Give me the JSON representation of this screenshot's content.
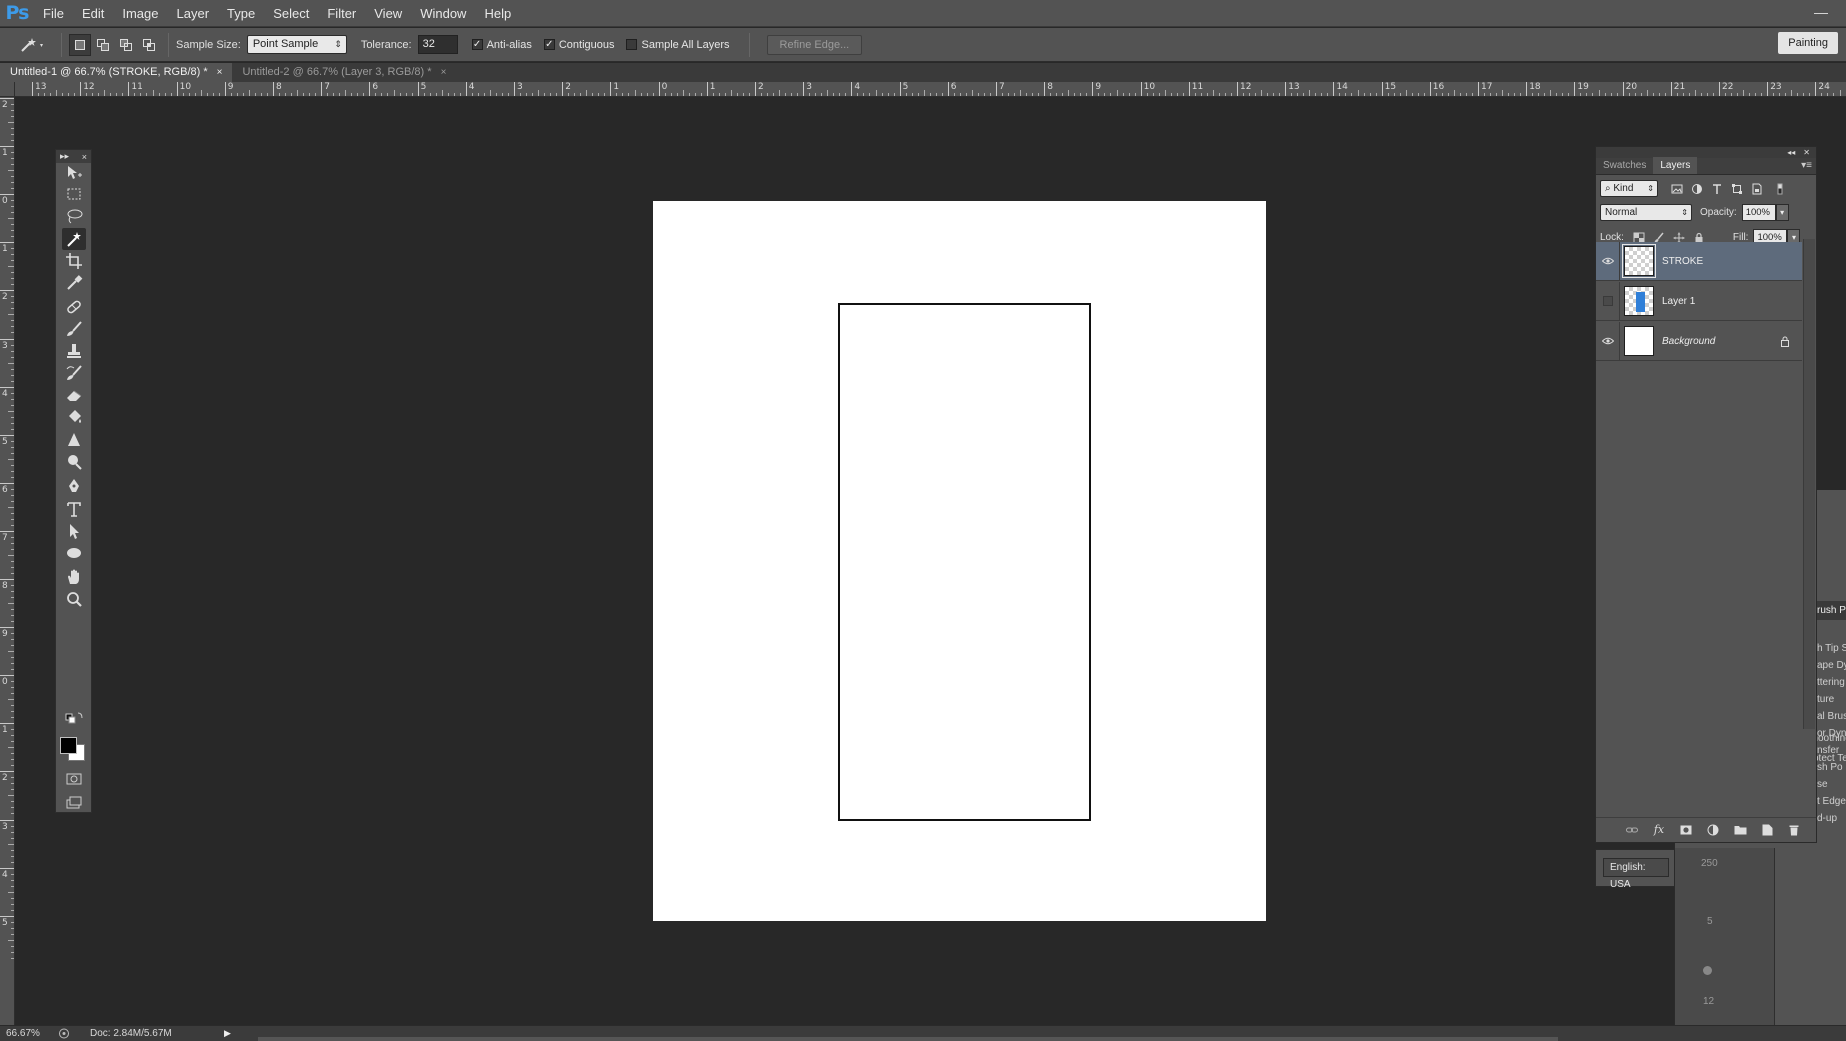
{
  "app": {
    "logo": "Ps"
  },
  "menu": [
    "File",
    "Edit",
    "Image",
    "Layer",
    "Type",
    "Select",
    "Filter",
    "View",
    "Window",
    "Help"
  ],
  "options": {
    "sample_size_label": "Sample Size:",
    "sample_size_value": "Point Sample",
    "tolerance_label": "Tolerance:",
    "tolerance_value": "32",
    "anti_alias_label": "Anti-alias",
    "anti_alias_checked": true,
    "contiguous_label": "Contiguous",
    "contiguous_checked": true,
    "sample_all_layers_label": "Sample All Layers",
    "sample_all_layers_checked": false,
    "refine_edge_label": "Refine Edge...",
    "workspace_label": "Painting"
  },
  "tabs": [
    {
      "label": "Untitled-1 @ 66.7% (STROKE, RGB/8) *",
      "close": "×",
      "active": true
    },
    {
      "label": "Untitled-2 @ 66.7% (Layer 3, RGB/8) *",
      "close": "×",
      "active": false
    }
  ],
  "ruler_top": [
    "13",
    "12",
    "11",
    "10",
    "9",
    "8",
    "7",
    "6",
    "5",
    "4",
    "3",
    "2",
    "1",
    "0",
    "1",
    "2",
    "3",
    "4",
    "5",
    "6",
    "7",
    "8",
    "9",
    "10",
    "11",
    "12",
    "13",
    "14",
    "15",
    "16",
    "17",
    "18",
    "19",
    "20",
    "21",
    "22",
    "23",
    "24"
  ],
  "ruler_left": [
    "2",
    "1",
    "0",
    "1",
    "2",
    "3",
    "4",
    "5",
    "6",
    "7",
    "8",
    "9",
    "0",
    "1",
    "2",
    "3",
    "4",
    "5"
  ],
  "toolbox": {
    "header_left": "▸▸",
    "header_close": "×",
    "tools": [
      {
        "name": "move-tool-icon"
      },
      {
        "name": "marquee-tool-icon"
      },
      {
        "name": "lasso-tool-icon"
      },
      {
        "name": "magic-wand-tool-icon",
        "active": true
      },
      {
        "name": "crop-tool-icon"
      },
      {
        "name": "eyedropper-tool-icon"
      },
      {
        "name": "healing-brush-tool-icon"
      },
      {
        "name": "brush-tool-icon"
      },
      {
        "name": "clone-stamp-tool-icon"
      },
      {
        "name": "history-brush-tool-icon"
      },
      {
        "name": "eraser-tool-icon"
      },
      {
        "name": "paint-bucket-tool-icon"
      },
      {
        "name": "blur-tool-icon"
      },
      {
        "name": "dodge-tool-icon"
      },
      {
        "name": "pen-tool-icon"
      },
      {
        "name": "type-tool-icon"
      },
      {
        "name": "path-selection-tool-icon"
      },
      {
        "name": "ellipse-tool-icon"
      },
      {
        "name": "hand-tool-icon"
      },
      {
        "name": "zoom-tool-icon"
      }
    ],
    "foreground_color": "#000000",
    "background_color": "#ffffff"
  },
  "layers_panel": {
    "tabs": [
      {
        "label": "Swatches",
        "active": false
      },
      {
        "label": "Layers",
        "active": true
      }
    ],
    "filter_kind": "Kind",
    "blend_mode": "Normal",
    "opacity_label": "Opacity:",
    "opacity_value": "100%",
    "lock_label": "Lock:",
    "fill_label": "Fill:",
    "fill_value": "100%",
    "layers": [
      {
        "name": "STROKE",
        "visible": true,
        "selected": true,
        "thumb": "transparent"
      },
      {
        "name": "Layer 1",
        "visible": false,
        "selected": false,
        "thumb": "blue-rect"
      },
      {
        "name": "Background",
        "visible": true,
        "selected": false,
        "thumb": "white",
        "locked": true,
        "italic": true
      }
    ],
    "footer": [
      "link-icon",
      "fx-icon",
      "mask-icon",
      "adjustment-icon",
      "folder-icon",
      "new-layer-icon",
      "trash-icon"
    ],
    "fx_label": "fx"
  },
  "language": "English: USA",
  "brush_panel": {
    "tab": "rush P",
    "items": [
      "h Tip S",
      "ape Dy",
      "ttering",
      "ture",
      "al Brus",
      "or Dyn",
      "nsfer",
      "sh Po",
      "se",
      "t Edge",
      "d-up"
    ],
    "smoothing": "Smoothing",
    "protect": "Protect Te",
    "size_250": "250",
    "size_5": "5",
    "size_12": "12"
  },
  "status": {
    "zoom": "66.67%",
    "doc": "Doc: 2.84M/5.67M"
  }
}
